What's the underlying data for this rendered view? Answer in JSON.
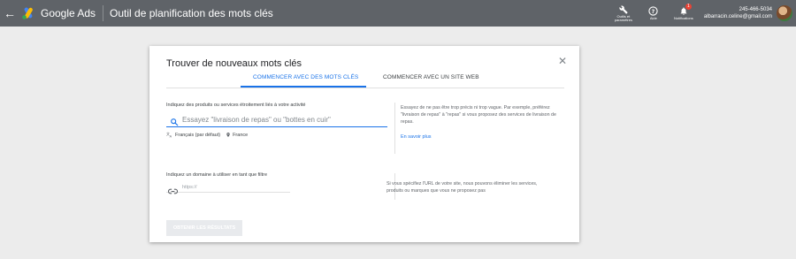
{
  "topbar": {
    "back_icon": "arrow-left-icon",
    "brand": "Google Ads",
    "page_title": "Outil de planification des mots clés",
    "tools": [
      {
        "icon": "wrench-icon",
        "label_line1": "Outils et",
        "label_line2": "paramètres"
      },
      {
        "icon": "help-icon",
        "label_line1": "Aide",
        "label_line2": ""
      },
      {
        "icon": "bell-icon",
        "label_line1": "Notifications",
        "label_line2": "",
        "badge": "1"
      }
    ],
    "account": {
      "phone": "245-466-5034",
      "email": "albarracin.celine@gmail.com"
    }
  },
  "card": {
    "title": "Trouver de nouveaux mots clés",
    "close_icon": "close-icon",
    "tabs": [
      {
        "label": "COMMENCER AVEC DES MOTS CLÉS",
        "active": true
      },
      {
        "label": "COMMENCER AVEC UN SITE WEB",
        "active": false
      }
    ],
    "keywords": {
      "label": "Indiquez des produits ou services étroitement liés à votre activité",
      "placeholder": "Essayez \"livraison de repas\" ou \"bottes en cuir\"",
      "language": "Français (par défaut)",
      "location": "France",
      "hint": "Essayez de ne pas être trop précis ni trop vague. Par exemple, préférez \"livraison de repas\" à \"repas\" si vous proposez des services de livraison de repas.",
      "learn_more": "En savoir plus"
    },
    "domain": {
      "label": "Indiquez un domaine à utiliser en tant que filtre",
      "placeholder": "https://",
      "hint": "Si vous spécifiez l'URL de votre site, nous pouvons éliminer les services, produits ou marques que vous ne proposez pas"
    },
    "submit_label": "OBTENIR LES RÉSULTATS"
  },
  "colors": {
    "accent": "#1a73e8",
    "topbar": "#5f6368",
    "background": "#ececec"
  }
}
